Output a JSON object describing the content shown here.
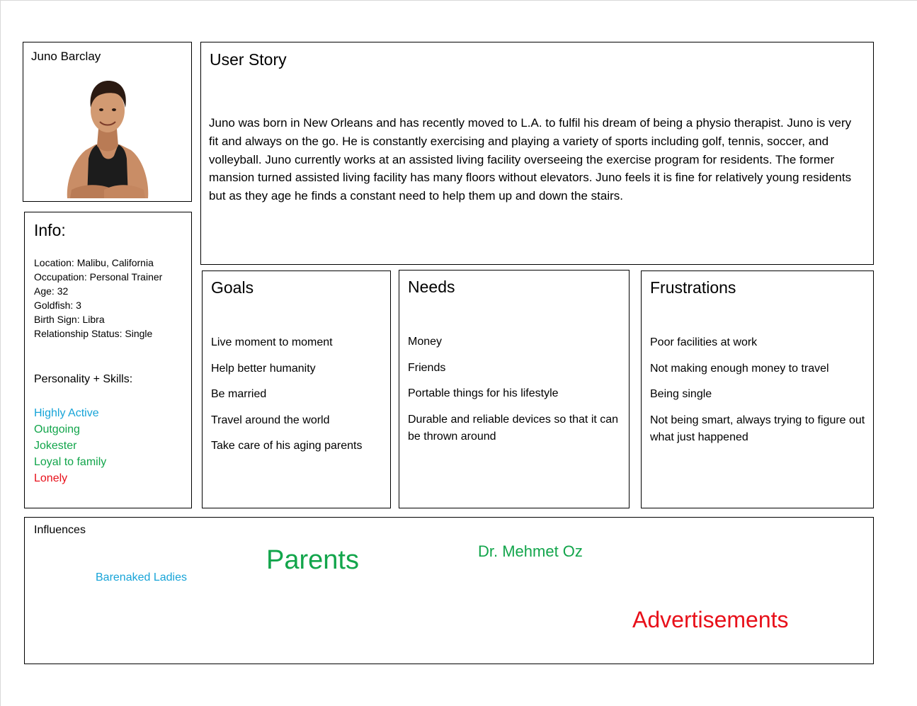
{
  "persona": {
    "name": "Juno Barclay"
  },
  "info": {
    "title": "Info:",
    "items": [
      "Location: Malibu, California",
      "Occupation: Personal Trainer",
      "Age: 32",
      "Goldfish: 3",
      "Birth Sign: Libra",
      "Relationship Status: Single"
    ],
    "skills_heading": "Personality + Skills:",
    "skills": [
      {
        "label": "Highly Active",
        "color": "#17a4d8"
      },
      {
        "label": "Outgoing",
        "color": "#12a54b"
      },
      {
        "label": "Jokester",
        "color": "#12a54b"
      },
      {
        "label": "Loyal to family",
        "color": "#12a54b"
      },
      {
        "label": "Lonely",
        "color": "#e8101a"
      }
    ]
  },
  "user_story": {
    "title": "User Story",
    "text": "Juno was born in New Orleans and has recently moved to L.A. to fulfil his dream of being a physio therapist. Juno is very fit and always on the go. He is constantly exercising and playing a variety of sports including golf, tennis, soccer, and volleyball. Juno currently works at an assisted living facility overseeing the exercise program for residents. The former mansion turned assisted living facility has many floors without elevators. Juno feels it is fine for relatively young residents but as they age he finds a constant need to help them up and down the stairs."
  },
  "goals": {
    "title": "Goals",
    "items": [
      "Live moment to moment",
      "Help better humanity",
      "Be married",
      "Travel around the world",
      "Take care of his aging parents"
    ]
  },
  "needs": {
    "title": "Needs",
    "items": [
      "Money",
      "Friends",
      "Portable things for his lifestyle",
      "Durable and reliable devices so that it can be thrown around"
    ]
  },
  "frustrations": {
    "title": "Frustrations",
    "items": [
      "Poor facilities at work",
      "Not making enough money to travel",
      "Being single",
      "Not being smart, always trying to figure out what just happened"
    ]
  },
  "influences": {
    "label": "Influences",
    "items": {
      "barenaked": {
        "label": "Barenaked Ladies",
        "color": "#17a4d8"
      },
      "parents": {
        "label": "Parents",
        "color": "#12a54b"
      },
      "oz": {
        "label": "Dr. Mehmet Oz",
        "color": "#12a54b"
      },
      "ads": {
        "label": "Advertisements",
        "color": "#e8101a"
      }
    }
  },
  "icons": {
    "portrait": "person-portrait-icon"
  }
}
